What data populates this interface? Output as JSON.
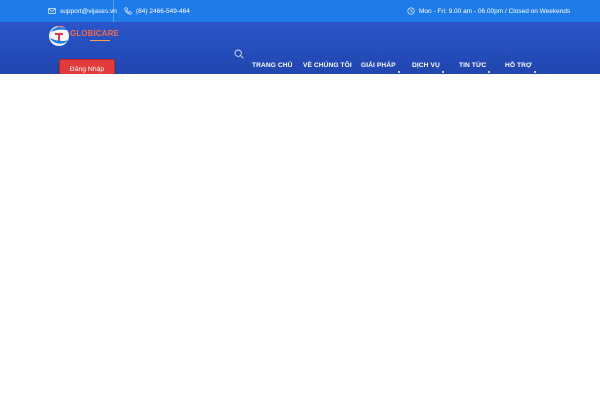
{
  "topbar": {
    "email": "support@vijases.vn",
    "phone": "(84) 2466-549-464",
    "hours": "Mon - Fri: 9.00 am - 06.00pm / Closed on Weekends"
  },
  "header": {
    "logo_text": "GLOBICARE",
    "login_label": "Đăng Nhập"
  },
  "nav": {
    "items": [
      {
        "label": "TRANG CHỦ"
      },
      {
        "label": "VỀ CHÚNG TÔI"
      },
      {
        "label": "GIẢI PHÁP"
      },
      {
        "label": "DỊCH VỤ"
      },
      {
        "label": "TIN TỨC"
      },
      {
        "label": "HỖ TRỢ"
      }
    ]
  },
  "colors": {
    "topbar": "#1e7bea",
    "header": "#2146b0",
    "login_button": "#e23b3b",
    "logo_accent": "#f36b4a"
  }
}
